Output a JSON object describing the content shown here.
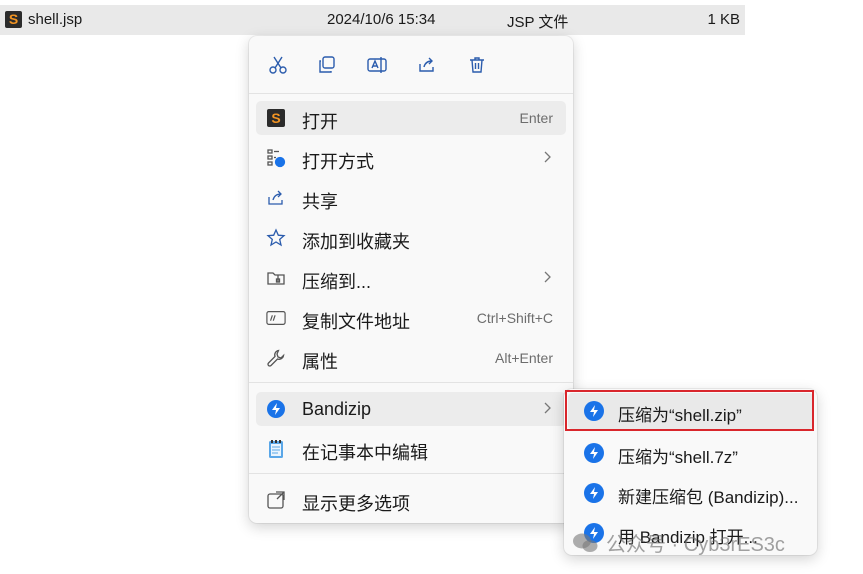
{
  "file": {
    "name": "shell.jsp",
    "date": "2024/10/6 15:34",
    "type": "JSP 文件",
    "size": "1 KB",
    "icon": "sublime-file-icon"
  },
  "toolbar": [
    {
      "name": "cut-button",
      "icon": "scissors-icon"
    },
    {
      "name": "copy-button",
      "icon": "copy-icon"
    },
    {
      "name": "rename-button",
      "icon": "rename-icon"
    },
    {
      "name": "share-button",
      "icon": "share-icon"
    },
    {
      "name": "delete-button",
      "icon": "trash-icon"
    }
  ],
  "menu": {
    "items": [
      {
        "label": "打开",
        "shortcut": "Enter",
        "icon": "sublime-icon"
      },
      {
        "label": "打开方式",
        "icon": "open-with-icon",
        "submenu": true
      },
      {
        "label": "共享",
        "icon": "share-icon"
      },
      {
        "label": "添加到收藏夹",
        "icon": "star-icon"
      },
      {
        "label": "压缩到...",
        "icon": "zip-folder-icon",
        "submenu": true
      },
      {
        "label": "复制文件地址",
        "shortcut": "Ctrl+Shift+C",
        "icon": "copy-path-icon"
      },
      {
        "label": "属性",
        "shortcut": "Alt+Enter",
        "icon": "wrench-icon"
      },
      {
        "label": "Bandizip",
        "icon": "bandizip-icon",
        "submenu": true
      },
      {
        "label": "在记事本中编辑",
        "icon": "notepad-icon"
      },
      {
        "label": "显示更多选项",
        "icon": "more-options-icon"
      }
    ]
  },
  "submenu": {
    "items": [
      {
        "label": "压缩为“shell.zip”"
      },
      {
        "label": "压缩为“shell.7z”"
      },
      {
        "label": "新建压缩包 (Bandizip)..."
      },
      {
        "label": "用 Bandizip 打开..."
      }
    ]
  },
  "watermark": {
    "text": "公众号 · Cyb3rES3c"
  },
  "colors": {
    "highlight_border": "#d9262c",
    "bandizip_blue": "#1a73e8",
    "sublime_orange": "#f29423"
  }
}
